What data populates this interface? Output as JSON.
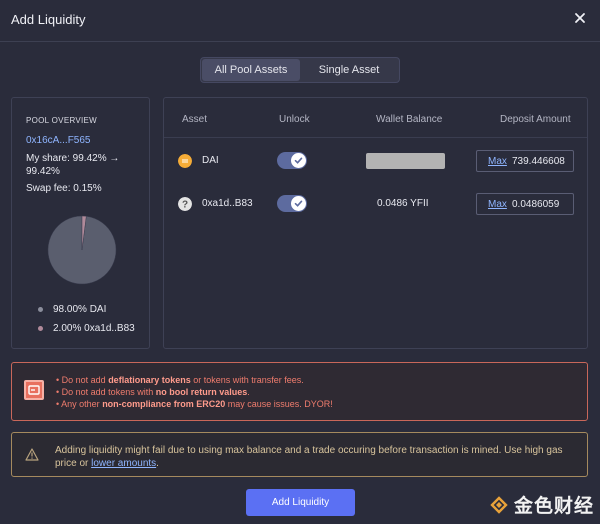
{
  "modal": {
    "title": "Add Liquidity"
  },
  "tabs": [
    "All Pool Assets",
    "Single Asset"
  ],
  "overview": {
    "heading": "POOL OVERVIEW",
    "address": "0x16cA...F565",
    "share_line1": "My share: 99.42% →",
    "share_line2": "99.42%",
    "swap_fee": "Swap fee: 0.15%",
    "legend": [
      {
        "label": "98.00% DAI",
        "percent": 98.0,
        "color": "#5a5e6e"
      },
      {
        "label": "2.00% 0xa1d..B83",
        "percent": 2.0,
        "color": "#b08a9a"
      }
    ]
  },
  "table": {
    "headers": [
      "Asset",
      "Unlock",
      "Wallet Balance",
      "Deposit Amount"
    ],
    "rows": [
      {
        "asset": "DAI",
        "icon": "dai-coin-icon",
        "unlocked": true,
        "balance": "",
        "max_label": "Max",
        "deposit": "739.446608"
      },
      {
        "asset": "0xa1d..B83",
        "icon": "unknown-token-icon",
        "unlocked": true,
        "balance": "0.0486 YFII",
        "max_label": "Max",
        "deposit": "0.0486059"
      }
    ]
  },
  "warning_tokens": {
    "lines": [
      [
        "• Do not add ",
        "deflationary tokens",
        " or tokens with transfer fees."
      ],
      [
        "• Do not add tokens with ",
        "no bool return values",
        "."
      ],
      [
        "• Any other ",
        "non-compliance from ERC20",
        " may cause issues. DYOR!"
      ]
    ]
  },
  "warning_liquidity": {
    "text": "Adding liquidity might fail due to using max balance and a trade occuring before transaction is mined. Use high gas price or ",
    "link": "lower amounts",
    "suffix": "."
  },
  "button": {
    "label": "Add Liquidity"
  },
  "watermark": {
    "text": "金色财经"
  },
  "colors": {
    "accent": "#5b70f3",
    "link": "#8fb5ff",
    "danger": "#e8705f",
    "caution": "#a58a5e"
  }
}
